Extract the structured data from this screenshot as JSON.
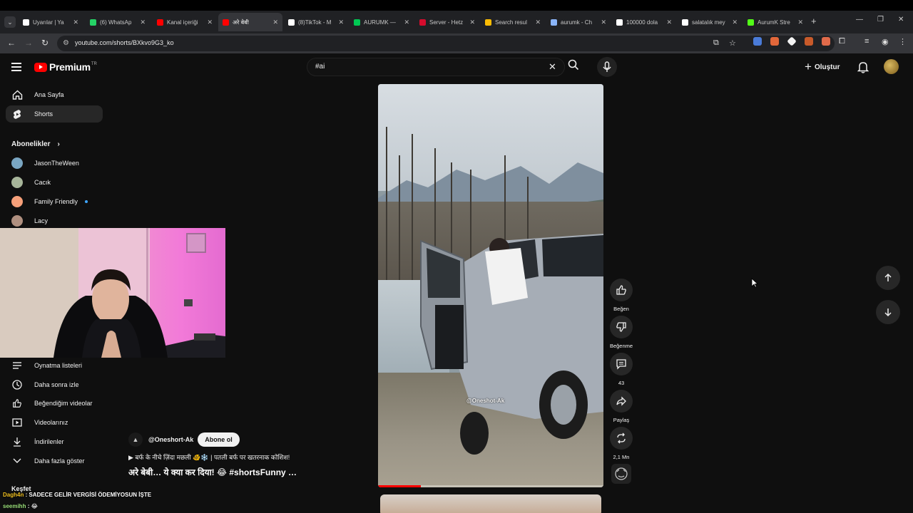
{
  "browser": {
    "tabs": [
      {
        "label": "Uyarılar | Ya",
        "color": "#ffffff"
      },
      {
        "label": "(6) WhatsAp",
        "color": "#25d366"
      },
      {
        "label": "Kanal içeriği",
        "color": "#ff0000"
      },
      {
        "label": "अरे बेबी",
        "color": "#ff0000",
        "active": true
      },
      {
        "label": "(8)TikTok - M",
        "color": "#ffffff"
      },
      {
        "label": "AURUMK —",
        "color": "#00c853"
      },
      {
        "label": "Server - Hetz",
        "color": "#d50c2d"
      },
      {
        "label": "Search resul",
        "color": "#fbbc04"
      },
      {
        "label": "aurumk - Ch",
        "color": "#8ab4f8"
      },
      {
        "label": "100000 dola",
        "color": "#ffffff"
      },
      {
        "label": "salatalık mey",
        "color": "#ffffff"
      },
      {
        "label": "AurumK Stre",
        "color": "#53fc18"
      }
    ],
    "url": "youtube.com/shorts/BXkvo9G3_ko"
  },
  "youtube": {
    "logo_text": "Premium",
    "logo_tm": "TR",
    "search_value": "#ai",
    "create_label": "Oluştur"
  },
  "sidebar": {
    "home": "Ana Sayfa",
    "shorts": "Shorts",
    "subscriptions_heading": "Abonelikler",
    "subscriptions": [
      {
        "name": "JasonTheWeen",
        "color": "#7aa6c2"
      },
      {
        "name": "Cacık",
        "color": "#a7b59a"
      },
      {
        "name": "Family Friendly",
        "color": "#f6a07a"
      },
      {
        "name": "Lacy",
        "color": "#b09080"
      }
    ],
    "library": [
      {
        "label": "Oynatma listeleri",
        "icon": "playlist-icon"
      },
      {
        "label": "Daha sonra izle",
        "icon": "clock-icon"
      },
      {
        "label": "Beğendiğim videolar",
        "icon": "thumb-up-icon"
      },
      {
        "label": "Videolarınız",
        "icon": "video-icon"
      },
      {
        "label": "İndirilenler",
        "icon": "download-icon"
      },
      {
        "label": "Daha fazla göster",
        "icon": "chevron-down-icon"
      }
    ],
    "explore_heading": "Keşfet"
  },
  "short": {
    "watermark": "@Oneshot-Ak",
    "channel": "@Oneshort-Ak",
    "subscribe_label": "Abone ol",
    "song": "बर्फ के नीचे ज़िंदा मछली 🐠❄️ | पतली बर्फ पर खतरनाक कोशिश!",
    "title": "अरे बेबी… ये क्या कर दिया! 😂 #shortsFunny …",
    "progress": 0.19,
    "actions": {
      "like": "Beğen",
      "dislike": "Beğenme",
      "comments": "43",
      "share": "Paylaş",
      "remix": "2,1 Mn"
    }
  },
  "chat": [
    {
      "user": "Dagh4n",
      "message": "SADECE GELİR VERGİSİ ÖDEMİYOSUN İŞTE",
      "user_color": "#f0c020"
    },
    {
      "user": "seemihh",
      "message": "😂",
      "user_color": "#9be07a"
    }
  ]
}
